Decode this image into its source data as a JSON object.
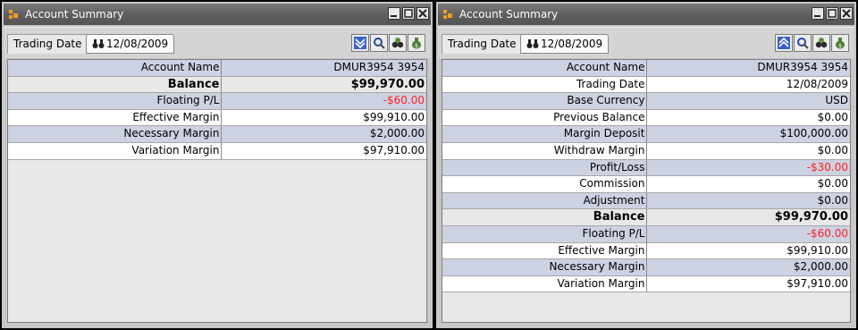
{
  "left_panel": {
    "title": "Account Summary",
    "trading_date_label": "Trading Date",
    "trading_date": "12/08/2009",
    "rows": [
      {
        "label": "Account Name",
        "value": "DMUR3954 3954",
        "style": "alt"
      },
      {
        "label": "Balance",
        "value": "$99,970.00",
        "style": "bold"
      },
      {
        "label": "Floating P/L",
        "value": "-$60.00",
        "style": "alt",
        "negative": true
      },
      {
        "label": "Effective Margin",
        "value": "$99,910.00",
        "style": "white"
      },
      {
        "label": "Necessary Margin",
        "value": "$2,000.00",
        "style": "alt"
      },
      {
        "label": "Variation Margin",
        "value": "$97,910.00",
        "style": "white"
      }
    ]
  },
  "right_panel": {
    "title": "Account Summary",
    "trading_date_label": "Trading Date",
    "trading_date": "12/08/2009",
    "rows": [
      {
        "label": "Account Name",
        "value": "DMUR3954 3954",
        "style": "alt"
      },
      {
        "label": "Trading Date",
        "value": "12/08/2009",
        "style": "white"
      },
      {
        "label": "Base Currency",
        "value": "USD",
        "style": "alt"
      },
      {
        "label": "Previous Balance",
        "value": "$0.00",
        "style": "white"
      },
      {
        "label": "Margin Deposit",
        "value": "$100,000.00",
        "style": "alt"
      },
      {
        "label": "Withdraw Margin",
        "value": "$0.00",
        "style": "white"
      },
      {
        "label": "Profit/Loss",
        "value": "-$30.00",
        "style": "alt",
        "negative": true
      },
      {
        "label": "Commission",
        "value": "$0.00",
        "style": "white"
      },
      {
        "label": "Adjustment",
        "value": "$0.00",
        "style": "alt"
      },
      {
        "label": "Balance",
        "value": "$99,970.00",
        "style": "bold"
      },
      {
        "label": "Floating P/L",
        "value": "-$60.00",
        "style": "alt",
        "negative": true
      },
      {
        "label": "Effective Margin",
        "value": "$99,910.00",
        "style": "white"
      },
      {
        "label": "Necessary Margin",
        "value": "$2,000.00",
        "style": "alt"
      },
      {
        "label": "Variation Margin",
        "value": "$97,910.00",
        "style": "white"
      }
    ]
  },
  "colors": {
    "alt_row": "#cdd2e3",
    "negative": "#ff2020",
    "titlebar": "#5d5d5d"
  },
  "icons": [
    "app-logo-icon",
    "minimize-icon",
    "maximize-icon",
    "close-icon",
    "binoculars-icon",
    "expand-collapse-icon",
    "search-icon",
    "find-icon",
    "money-bag-icon"
  ]
}
